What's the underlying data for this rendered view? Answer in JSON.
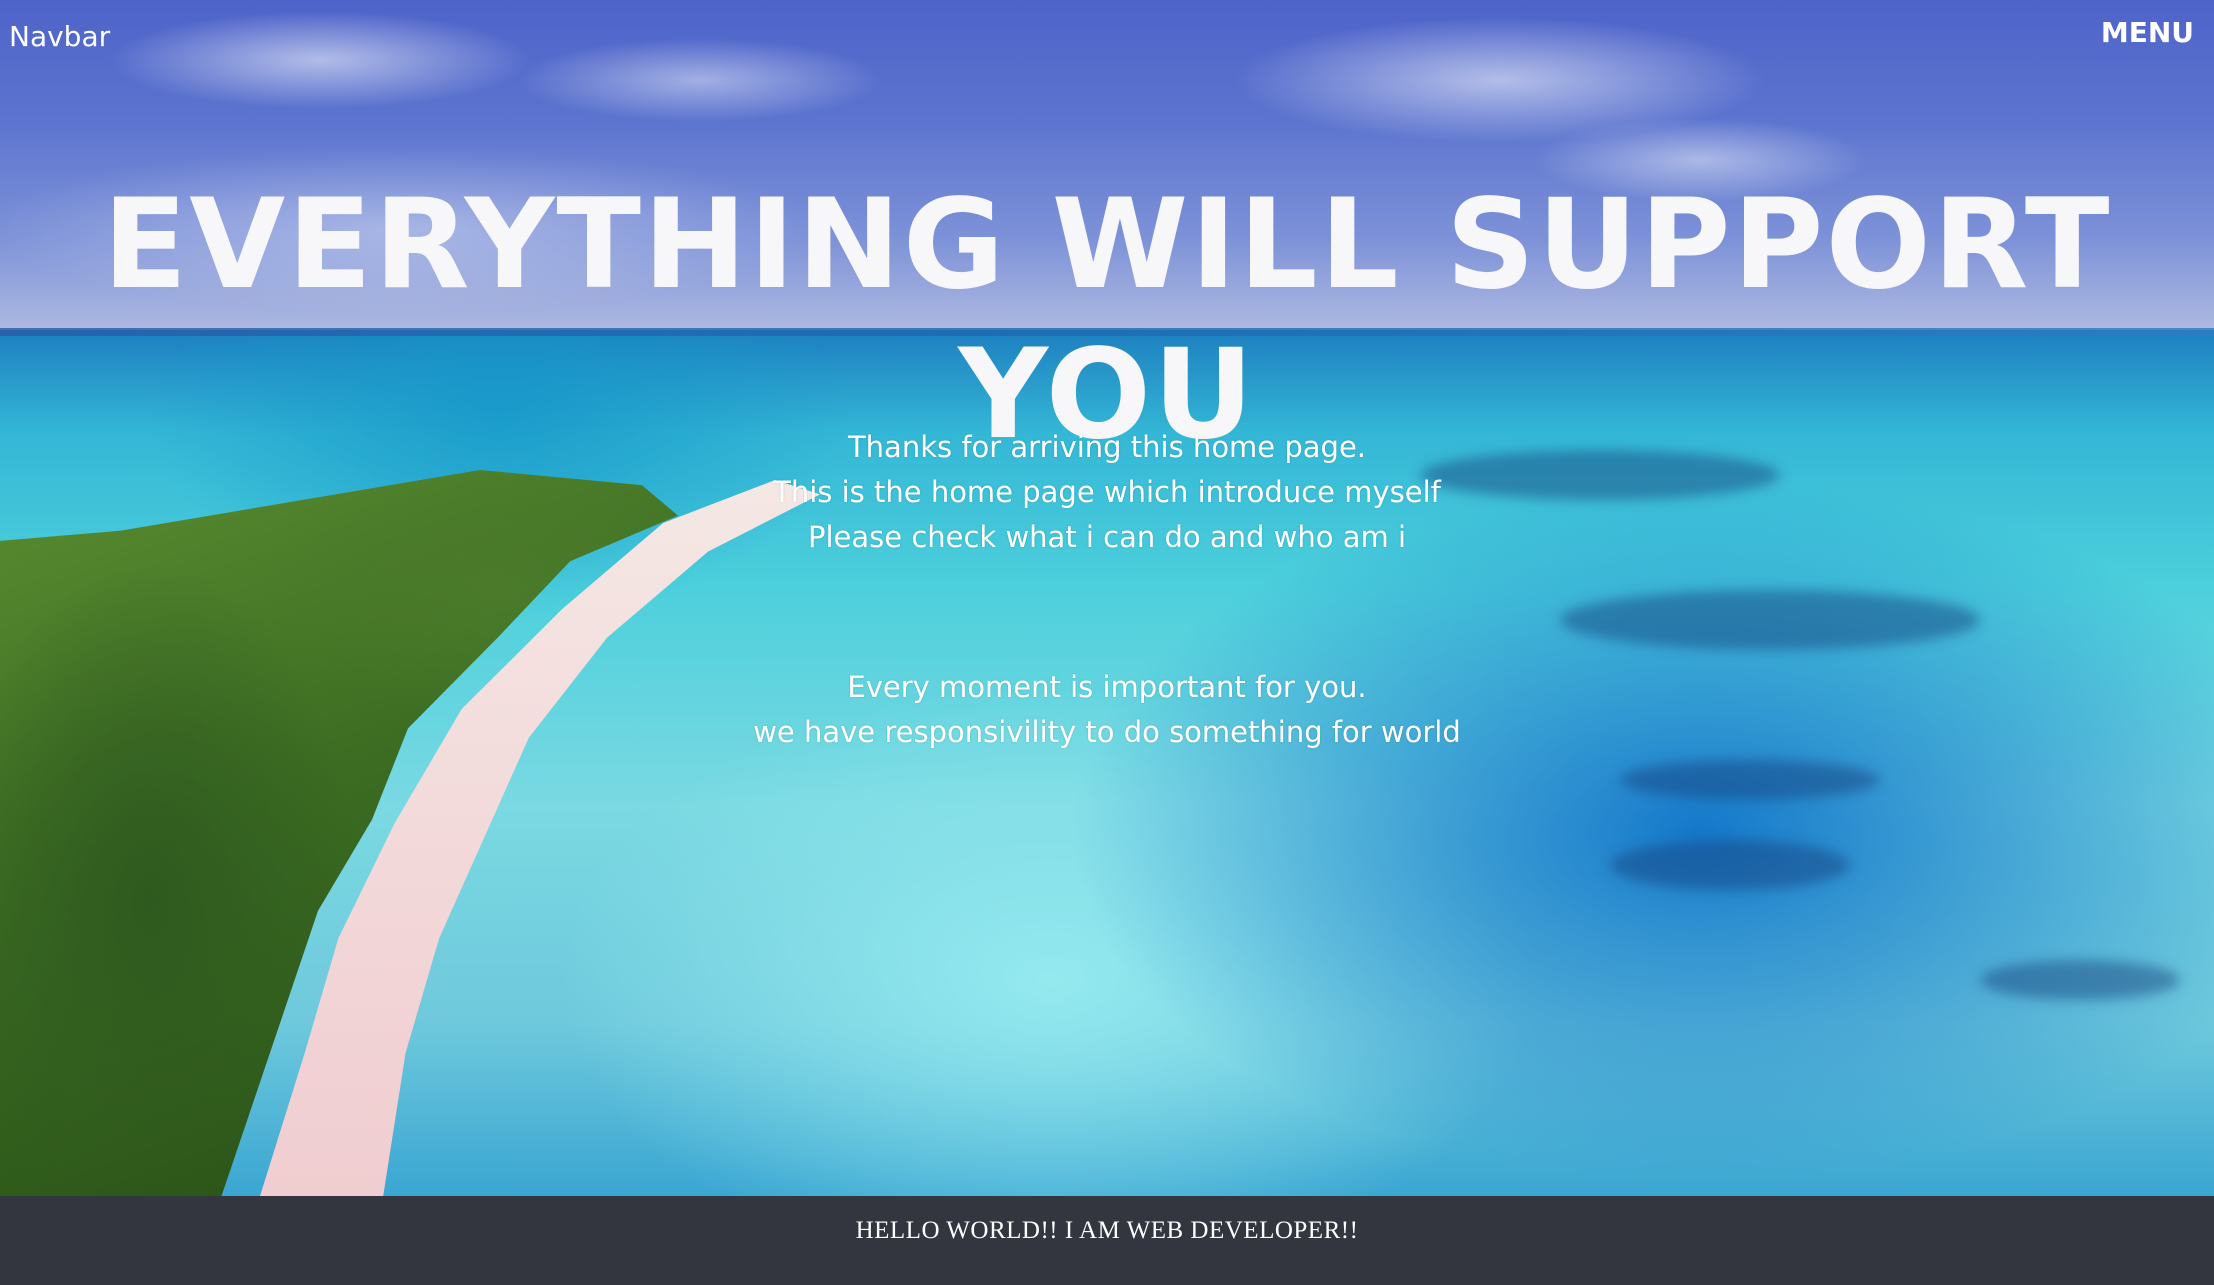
{
  "navbar": {
    "brand": "Navbar",
    "menu_label": "MENU"
  },
  "hero": {
    "title": "EVERYTHING WILL SUPPORT YOU",
    "intro_lines": [
      "Thanks for arriving this home page.",
      "This is the home page which introduce myself",
      "Please check what i can do and who am i"
    ],
    "message_lines": [
      "Every moment is important for you.",
      "we have responsivility to do something for world"
    ]
  },
  "footer": {
    "text": "HELLO WORLD!! I AM WEB DEVELOPER!!"
  },
  "colors": {
    "footer_bg": "#33363e",
    "text": "#ffffff"
  }
}
